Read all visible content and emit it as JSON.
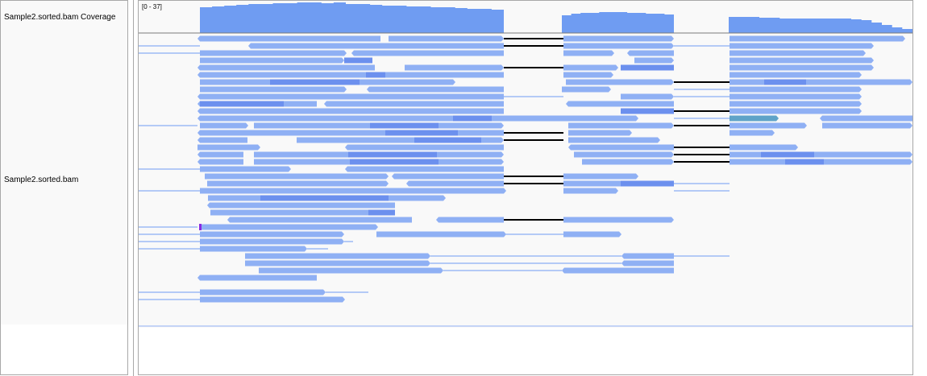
{
  "tracks": {
    "coverage_name": "Sample2.sorted.bam Coverage",
    "alignment_name": "Sample2.sorted.bam",
    "data_range": "[0 - 37]"
  },
  "colors": {
    "coverage": "#6f9cf2",
    "read": "#8fb0f4",
    "read_dark": "#6c90ee",
    "insert_line": "#6f9cf2",
    "splice": "#000000",
    "highlight_read": "#5fa3c8"
  }
}
